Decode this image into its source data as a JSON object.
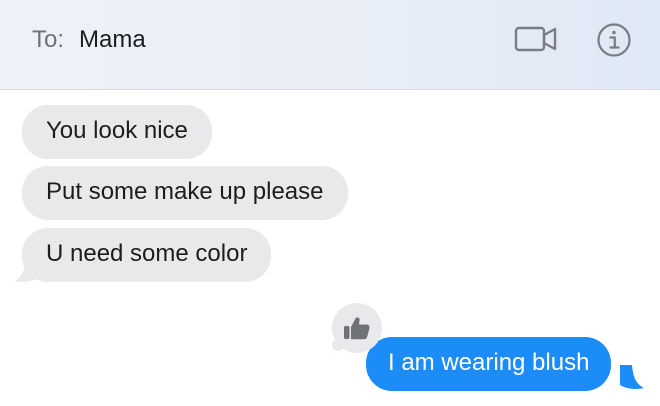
{
  "header": {
    "to_label": "To:",
    "recipient": "Mama",
    "video_icon": "video-camera-icon",
    "info_icon": "info-icon"
  },
  "messages": [
    {
      "direction": "incoming",
      "text": "You look nice"
    },
    {
      "direction": "incoming",
      "text": "Put some make up please"
    },
    {
      "direction": "incoming",
      "text": "U need some color"
    },
    {
      "direction": "outgoing",
      "text": "I am wearing blush",
      "reaction": "thumbs-up-icon"
    }
  ],
  "colors": {
    "incoming_bubble": "#e9e9eb",
    "outgoing_bubble": "#1b8cf8",
    "reaction_bubble": "#e9e9eb"
  }
}
